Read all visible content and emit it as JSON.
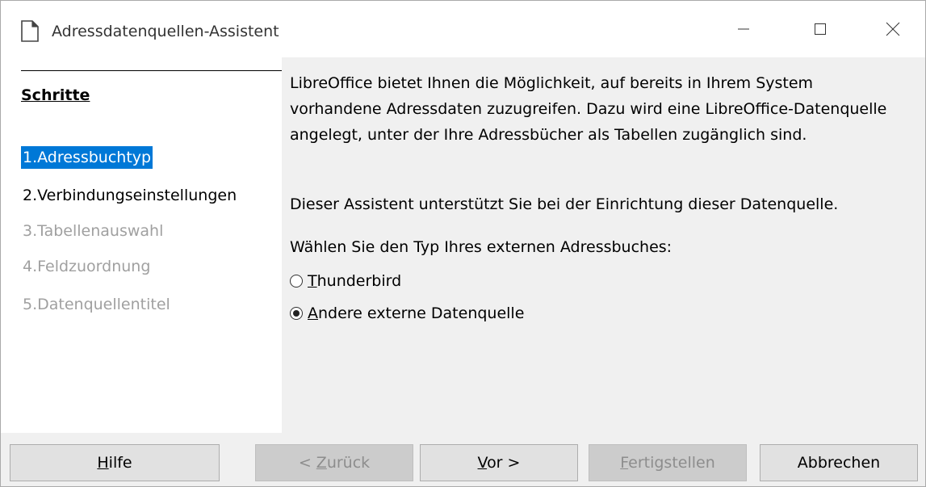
{
  "window": {
    "title": "Adressdatenquellen-Assistent"
  },
  "steps": {
    "heading": "Schritte",
    "items": [
      {
        "label": "1.Adressbuchtyp",
        "state": "active"
      },
      {
        "label": "2.Verbindungseinstellungen",
        "state": "enabled"
      },
      {
        "label": "3.Tabellenauswahl",
        "state": "disabled"
      },
      {
        "label": "4.Feldzuordnung",
        "state": "disabled"
      },
      {
        "label": "5.Datenquellentitel",
        "state": "disabled"
      }
    ]
  },
  "content": {
    "intro": "LibreOffice bietet Ihnen die Möglichkeit, auf bereits in Ihrem System vorhandene Adressdaten zuzugreifen. Dazu wird eine LibreOffice-Datenquelle angelegt, unter der Ihre Adressbücher als Tabellen zugänglich sind.",
    "assistant": "Dieser Assistent unterstützt Sie bei der Einrichtung dieser Datenquelle.",
    "choose": "Wählen Sie den Typ Ihres externen Adressbuches:",
    "options": [
      {
        "mnemonic": "T",
        "rest": "hunderbird",
        "selected": false
      },
      {
        "mnemonic": "A",
        "rest": "ndere externe Datenquelle",
        "selected": true
      }
    ]
  },
  "buttons": {
    "help": {
      "mnemonic": "H",
      "rest": "ilfe"
    },
    "back": {
      "prefix": "< ",
      "mnemonic": "Z",
      "rest": "urück"
    },
    "next": {
      "mnemonic": "V",
      "rest": "or >"
    },
    "finish": {
      "mnemonic": "F",
      "rest": "ertigstellen"
    },
    "cancel": {
      "label": "Abbrechen"
    }
  },
  "colors": {
    "selection": "#0078d7",
    "disabled_text": "#a0a0a0"
  }
}
